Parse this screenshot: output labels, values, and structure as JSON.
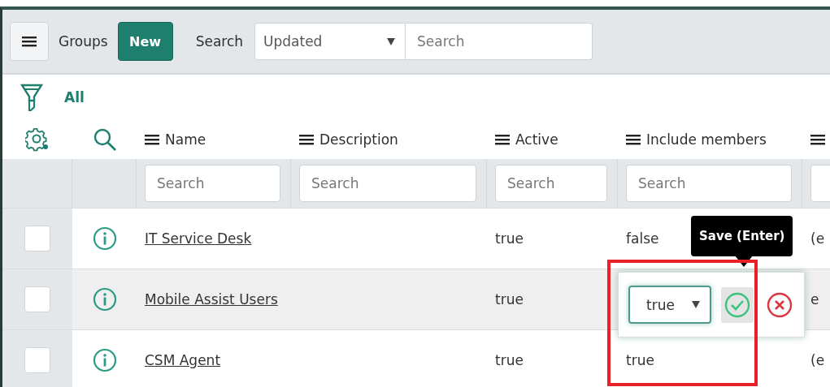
{
  "header": {
    "title": "Groups",
    "new_button": "New",
    "search_label": "Search",
    "search_field": {
      "value": "Updated"
    },
    "search_input": {
      "placeholder": "Search"
    }
  },
  "filter": {
    "label": "All"
  },
  "columns": [
    {
      "label": "Name",
      "search_placeholder": "Search"
    },
    {
      "label": "Description",
      "search_placeholder": "Search"
    },
    {
      "label": "Active",
      "search_placeholder": "Search"
    },
    {
      "label": "Include members",
      "search_placeholder": "Search"
    },
    {}
  ],
  "rows": [
    {
      "checked": false,
      "name": "IT Service Desk",
      "active": "true",
      "include_members": "false",
      "column_5": "(e"
    },
    {
      "checked": false,
      "name": "Mobile Assist Users",
      "active": "true",
      "column_5": "e",
      "editor": {
        "value": "true",
        "tooltip": "Save (Enter)",
        "annotation": {
          "kind": "rectangle"
        }
      }
    },
    {
      "checked": false,
      "name": "CSM Agent",
      "active": "true",
      "include_members": "true",
      "column_5": "(e"
    }
  ]
}
